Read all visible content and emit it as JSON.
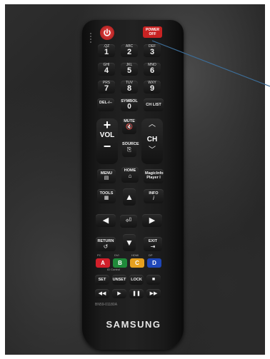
{
  "remote": {
    "power_off_label": "POWER OFF",
    "number_keys": [
      {
        "sub": ".QZ",
        "main": "1"
      },
      {
        "sub": "ABC",
        "main": "2"
      },
      {
        "sub": "DEF",
        "main": "3"
      },
      {
        "sub": "GHI",
        "main": "4"
      },
      {
        "sub": "JKL",
        "main": "5"
      },
      {
        "sub": "MNO",
        "main": "6"
      },
      {
        "sub": "PRS",
        "main": "7"
      },
      {
        "sub": "TUV",
        "main": "8"
      },
      {
        "sub": "WXY",
        "main": "9"
      }
    ],
    "del_label": "DEL-/--",
    "symbol_label": "SYMBOL",
    "zero_label": "0",
    "chlist_label": "CH LIST",
    "mute_label": "MUTE",
    "vol_label": "VOL",
    "ch_label": "CH",
    "source_label": "SOURCE",
    "menu_label": "MENU",
    "home_label": "HOME",
    "magicinfo_label": "MagicInfo Player I",
    "tools_label": "TOOLS",
    "info_label": "INFO",
    "return_label": "RETURN",
    "exit_label": "EXIT",
    "color_keys": [
      "A",
      "B",
      "C",
      "D"
    ],
    "color_key_colors": [
      "#d21f2a",
      "#1f8a3a",
      "#e5a020",
      "#1f47b8"
    ],
    "under_labels": [
      "PC",
      "DVI",
      "HDMI",
      "DP"
    ],
    "id_control_label": "ID Control",
    "set_label": "SET",
    "unset_label": "UNSET",
    "lock_label": "LOCK",
    "model": "BN59-01180A",
    "brand": "SAMSUNG"
  },
  "annotation": {
    "line_color": "#3d6e99"
  }
}
